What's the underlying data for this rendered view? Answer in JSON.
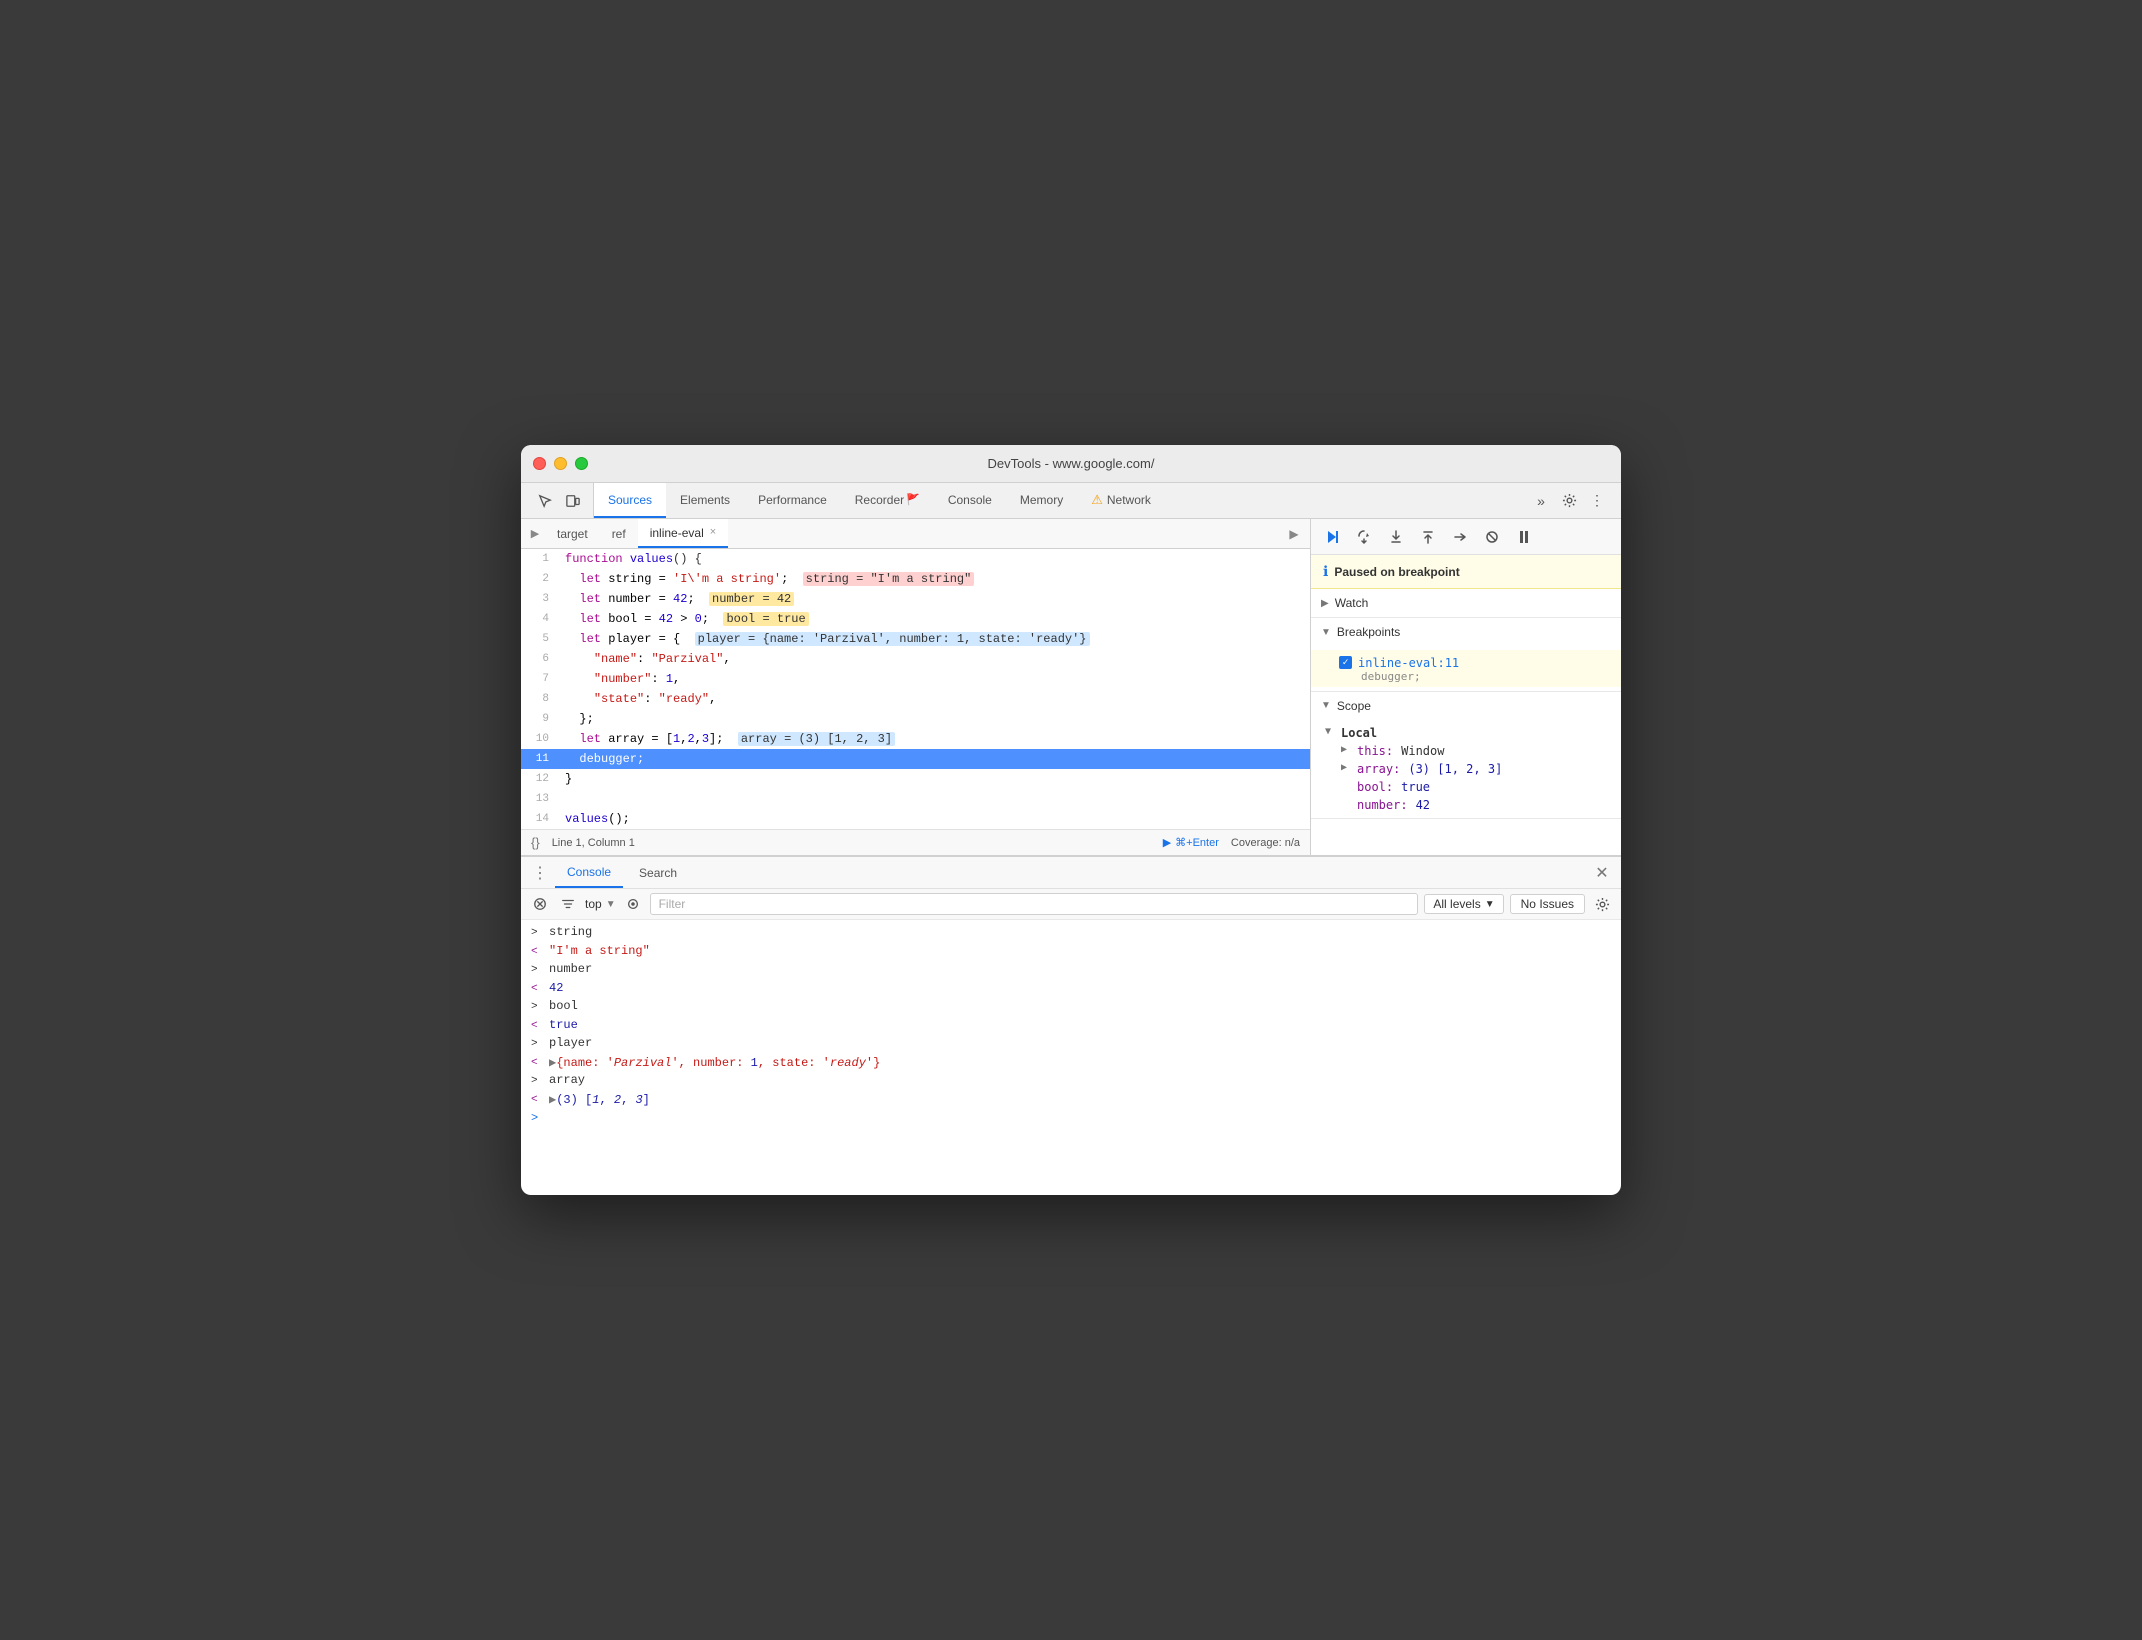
{
  "window": {
    "title": "DevTools - www.google.com/"
  },
  "tabs": {
    "items": [
      {
        "label": "Sources",
        "active": true
      },
      {
        "label": "Elements",
        "active": false
      },
      {
        "label": "Performance",
        "active": false
      },
      {
        "label": "Recorder",
        "active": false
      },
      {
        "label": "Console",
        "active": false
      },
      {
        "label": "Memory",
        "active": false
      },
      {
        "label": "Network",
        "active": false,
        "warning": true
      }
    ],
    "more_label": "»",
    "settings_label": "⚙",
    "more2_label": "⋮"
  },
  "source_tabs": {
    "items": [
      {
        "label": "target",
        "active": false,
        "closeable": false
      },
      {
        "label": "ref",
        "active": false,
        "closeable": false
      },
      {
        "label": "inline-eval",
        "active": true,
        "closeable": true
      }
    ]
  },
  "code": {
    "lines": [
      {
        "num": 1,
        "content": "function values() {"
      },
      {
        "num": 2,
        "content": "  let string = 'I\\'m a string';",
        "highlight": "string = \"I'm a string\"",
        "hl_type": "pink"
      },
      {
        "num": 3,
        "content": "  let number = 42;",
        "highlight": "number = 42",
        "hl_type": "yellow"
      },
      {
        "num": 4,
        "content": "  let bool = 42 > 0;",
        "highlight": "bool = true",
        "hl_type": "yellow"
      },
      {
        "num": 5,
        "content": "  let player = {",
        "highlight": "player = {name: 'Parzival', number: 1, state: 'ready'}",
        "hl_type": "blue"
      },
      {
        "num": 6,
        "content": "    \"name\": \"Parzival\","
      },
      {
        "num": 7,
        "content": "    \"number\": 1,"
      },
      {
        "num": 8,
        "content": "    \"state\": \"ready\","
      },
      {
        "num": 9,
        "content": "  };"
      },
      {
        "num": 10,
        "content": "  let array = [1,2,3];",
        "highlight": "array = (3) [1, 2, 3]",
        "hl_type": "blue"
      },
      {
        "num": 11,
        "content": "  debugger;",
        "active": true
      },
      {
        "num": 12,
        "content": "}"
      },
      {
        "num": 13,
        "content": ""
      },
      {
        "num": 14,
        "content": "values();"
      }
    ]
  },
  "status_bar": {
    "bracket_icon": "{}",
    "position": "Line 1, Column 1",
    "run_label": "⌘+Enter",
    "coverage": "Coverage: n/a"
  },
  "debugger": {
    "toolbar": {
      "resume": "▶",
      "step_over": "↻",
      "step_into": "↓",
      "step_out": "↑",
      "step": "→",
      "deactivate": "⊘",
      "pause_async": "⏸"
    },
    "breakpoint_message": "Paused on breakpoint",
    "sections": {
      "watch": {
        "label": "Watch",
        "collapsed": true
      },
      "breakpoints": {
        "label": "Breakpoints",
        "collapsed": false,
        "items": [
          {
            "filename": "inline-eval:11",
            "code": "debugger;"
          }
        ]
      },
      "scope": {
        "label": "Scope",
        "collapsed": false,
        "local_label": "Local",
        "items": [
          {
            "key": "this:",
            "val": "Window",
            "expandable": true
          },
          {
            "key": "array:",
            "val": "(3) [1, 2, 3]",
            "expandable": true
          },
          {
            "key": "bool:",
            "val": "true",
            "expandable": false
          },
          {
            "key": "number:",
            "val": "42",
            "expandable": false
          }
        ]
      }
    }
  },
  "console": {
    "tabs": [
      {
        "label": "Console",
        "active": true
      },
      {
        "label": "Search",
        "active": false
      }
    ],
    "toolbar": {
      "filter_placeholder": "Filter",
      "levels_label": "All levels",
      "no_issues_label": "No Issues"
    },
    "rows": [
      {
        "arrow": ">",
        "type": "right",
        "value": "string",
        "val_class": ""
      },
      {
        "arrow": "<",
        "type": "left",
        "value": "\"I'm a string\"",
        "val_class": "str"
      },
      {
        "arrow": ">",
        "type": "right",
        "value": "number",
        "val_class": ""
      },
      {
        "arrow": "<",
        "type": "left",
        "value": "42",
        "val_class": "num"
      },
      {
        "arrow": ">",
        "type": "right",
        "value": "bool",
        "val_class": ""
      },
      {
        "arrow": "<",
        "type": "left",
        "value": "true",
        "val_class": "bool"
      },
      {
        "arrow": ">",
        "type": "right",
        "value": "player",
        "val_class": ""
      },
      {
        "arrow": "<",
        "type": "left",
        "value": "▶{name: 'Parzival', number: 1, state: 'ready'}",
        "val_class": "obj"
      },
      {
        "arrow": ">",
        "type": "right",
        "value": "array",
        "val_class": ""
      },
      {
        "arrow": "<",
        "type": "left",
        "value": "▶(3) [1, 2, 3]",
        "val_class": "num"
      }
    ]
  }
}
